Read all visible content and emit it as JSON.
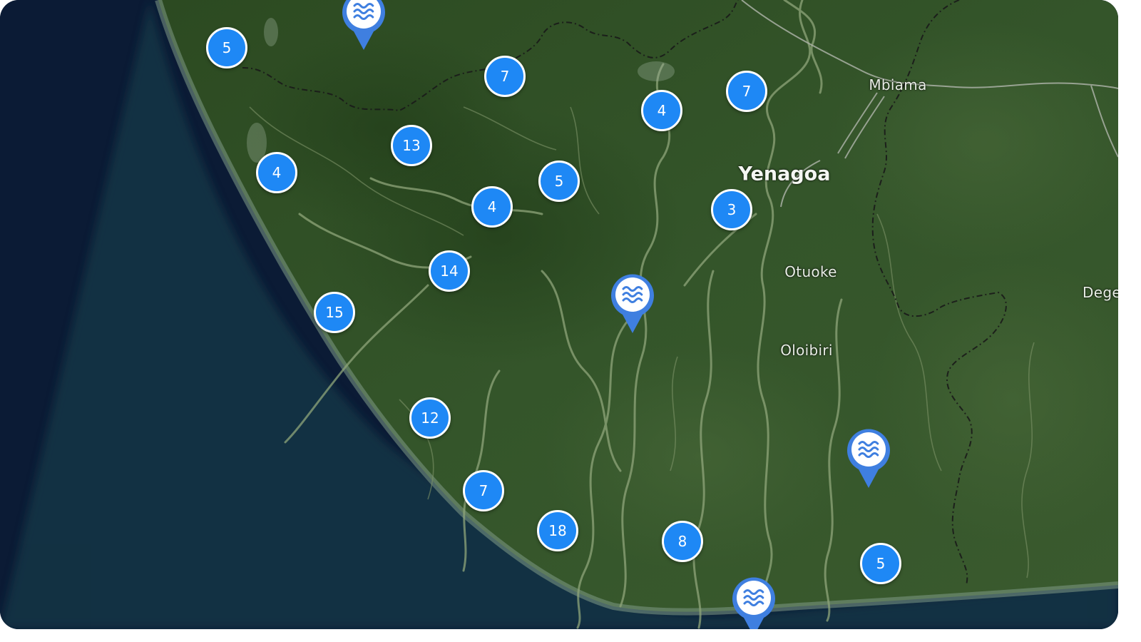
{
  "map": {
    "colors": {
      "ocean": "#0a1a33",
      "land": "#2f4f22",
      "river": "#8fa57a",
      "border": "#1a1a1a",
      "road": "#a9b0a4",
      "marker": "#1e88f5",
      "pin": "#3f7fe0"
    },
    "places": [
      {
        "id": "mbiama",
        "name": "Mbiama",
        "kind": "town"
      },
      {
        "id": "yenagoa",
        "name": "Yenagoa",
        "kind": "city"
      },
      {
        "id": "otuoke",
        "name": "Otuoke",
        "kind": "town"
      },
      {
        "id": "oloibiri",
        "name": "Oloibiri",
        "kind": "town"
      },
      {
        "id": "dege",
        "name": "Dege",
        "kind": "town"
      }
    ],
    "clusters": [
      {
        "id": "c1",
        "count": "5"
      },
      {
        "id": "c2",
        "count": "7"
      },
      {
        "id": "c3",
        "count": "4"
      },
      {
        "id": "c4",
        "count": "7"
      },
      {
        "id": "c5",
        "count": "13"
      },
      {
        "id": "c6",
        "count": "4"
      },
      {
        "id": "c7",
        "count": "5"
      },
      {
        "id": "c8",
        "count": "4"
      },
      {
        "id": "c9",
        "count": "3"
      },
      {
        "id": "c10",
        "count": "14"
      },
      {
        "id": "c11",
        "count": "15"
      },
      {
        "id": "c12",
        "count": "12"
      },
      {
        "id": "c13",
        "count": "7"
      },
      {
        "id": "c14",
        "count": "18"
      },
      {
        "id": "c15",
        "count": "8"
      },
      {
        "id": "c16",
        "count": "5"
      }
    ],
    "pins": [
      {
        "id": "p1",
        "icon": "water-waves-icon"
      },
      {
        "id": "p2",
        "icon": "water-waves-icon"
      },
      {
        "id": "p3",
        "icon": "water-waves-icon"
      },
      {
        "id": "p4",
        "icon": "water-waves-icon"
      }
    ]
  }
}
